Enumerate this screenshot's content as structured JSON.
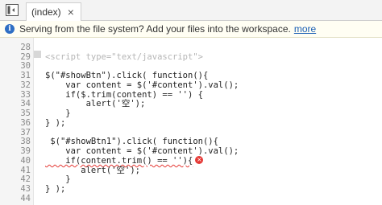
{
  "tab": {
    "label": "(index)",
    "close_label": "×"
  },
  "infobar": {
    "message": "Serving from the file system? Add your files into the workspace.",
    "more_link": "more"
  },
  "editor": {
    "lines": [
      {
        "num": "28",
        "text": "<script type=\"text/javascript\">"
      },
      {
        "num": "29",
        "text": ""
      },
      {
        "num": "30",
        "text": "$(\"#showBtn\").click( function(){"
      },
      {
        "num": "31",
        "text": "    var content = $('#content').val();"
      },
      {
        "num": "32",
        "text": "    if($.trim(content) == '') {"
      },
      {
        "num": "33",
        "text": "        alert('空');"
      },
      {
        "num": "34",
        "text": "    }"
      },
      {
        "num": "35",
        "text": "} );"
      },
      {
        "num": "36",
        "text": ""
      },
      {
        "num": "37",
        "text": " $(\"#showBtn1\").click( function(){"
      },
      {
        "num": "38",
        "text": "    var content = $('#content').val();"
      },
      {
        "num": "39",
        "text": "    if(content.trim() == ''){"
      },
      {
        "num": "40",
        "text": "       alert('空');"
      },
      {
        "num": "41",
        "text": "    }"
      },
      {
        "num": "42",
        "text": "} );"
      },
      {
        "num": "43",
        "text": ""
      },
      {
        "num": "44",
        "text": ""
      }
    ],
    "error_line_index": 11,
    "error_icon": "×"
  },
  "icons": {
    "toggle": "sidebar-toggle-icon",
    "info": "info-icon",
    "error": "error-icon",
    "close": "close-icon"
  },
  "colors": {
    "info_icon": "#2f6fc4",
    "error": "#e53935",
    "link": "#1a5fb4"
  }
}
